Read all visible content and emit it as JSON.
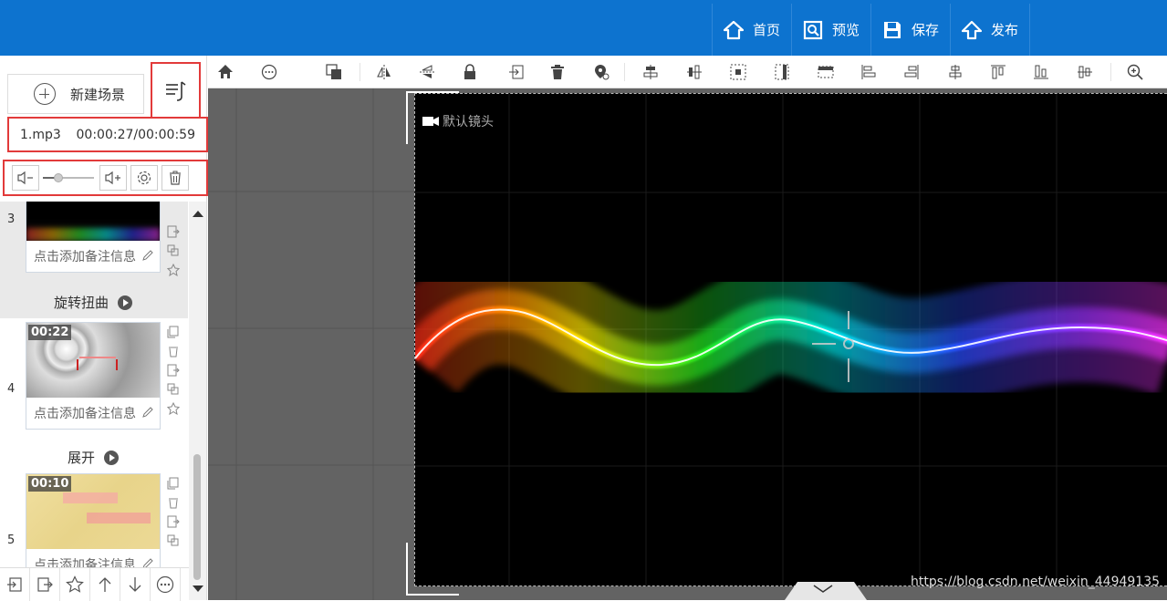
{
  "topnav": {
    "items": [
      {
        "label": "首页",
        "icon": "home-icon"
      },
      {
        "label": "预览",
        "icon": "preview-icon"
      },
      {
        "label": "保存",
        "icon": "save-icon"
      },
      {
        "label": "发布",
        "icon": "publish-icon"
      }
    ]
  },
  "leftpanel": {
    "new_scene_label": "新建场景",
    "audio": {
      "file_name": "1.mp3",
      "time": "00:00:27/00:00:59",
      "volume": 0.3
    },
    "scenes": [
      {
        "number": "3",
        "duration": "",
        "note": "点击添加备注信息",
        "effect": "旋转扭曲"
      },
      {
        "number": "4",
        "duration": "00:22",
        "note": "点击添加备注信息",
        "effect": "展开"
      },
      {
        "number": "5",
        "duration": "00:10",
        "note": "点击添加备注信息",
        "effect": ""
      }
    ]
  },
  "stage": {
    "camera_label": "默认镜头"
  },
  "watermark": "https://blog.csdn.net/weixin_44949135",
  "colors": {
    "topbar": "#0d73cf",
    "highlight_border": "#e23a3a",
    "canvas_bg": "#636363",
    "stage_bg": "#000000"
  }
}
